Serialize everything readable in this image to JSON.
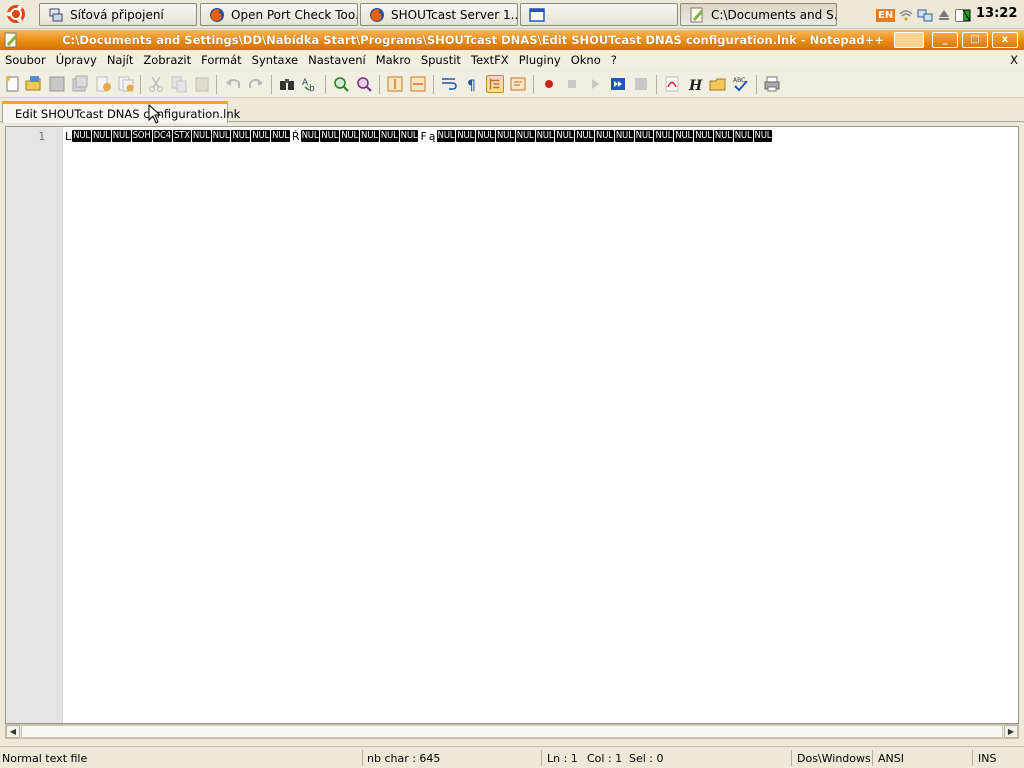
{
  "taskbar": {
    "buttons": [
      {
        "label": "Síťová připojení",
        "icon": "network-connections-icon"
      },
      {
        "label": "Open Port Check Too...",
        "icon": "firefox-icon"
      },
      {
        "label": "SHOUTcast Server 1....",
        "icon": "firefox-icon"
      },
      {
        "label": "",
        "icon": "window-icon"
      },
      {
        "label": "C:\\Documents and S...",
        "icon": "notepadpp-icon",
        "active": true
      }
    ],
    "tray": {
      "language": "EN",
      "clock": "13:22"
    }
  },
  "window": {
    "title": "C:\\Documents and Settings\\DD\\Nabídka Start\\Programs\\SHOUTcast DNAS\\Edit SHOUTcast DNAS configuration.lnk - Notepad++",
    "controls": [
      "_",
      "□",
      "x"
    ]
  },
  "menu": {
    "items": [
      "Soubor",
      "Úpravy",
      "Najít",
      "Zobrazit",
      "Formát",
      "Syntaxe",
      "Nastavení",
      "Makro",
      "Spustit",
      "TextFX",
      "Pluginy",
      "Okno",
      "?"
    ],
    "close": "X"
  },
  "tab": {
    "label": "Edit SHOUTcast DNAS configuration.lnk"
  },
  "editor": {
    "line_number": "1",
    "tokens": [
      {
        "t": "L",
        "ctrl": false
      },
      {
        "t": "NUL",
        "ctrl": true
      },
      {
        "t": "NUL",
        "ctrl": true
      },
      {
        "t": "NUL",
        "ctrl": true
      },
      {
        "t": "SOH",
        "ctrl": true
      },
      {
        "t": "DC4",
        "ctrl": true
      },
      {
        "t": "STX",
        "ctrl": true
      },
      {
        "t": "NUL",
        "ctrl": true
      },
      {
        "t": "NUL",
        "ctrl": true
      },
      {
        "t": "NUL",
        "ctrl": true
      },
      {
        "t": "NUL",
        "ctrl": true
      },
      {
        "t": "NUL",
        "ctrl": true
      },
      {
        "t": "Ŕ",
        "ctrl": false
      },
      {
        "t": "NUL",
        "ctrl": true
      },
      {
        "t": "NUL",
        "ctrl": true
      },
      {
        "t": "NUL",
        "ctrl": true
      },
      {
        "t": "NUL",
        "ctrl": true
      },
      {
        "t": "NUL",
        "ctrl": true
      },
      {
        "t": "NUL",
        "ctrl": true
      },
      {
        "t": "F",
        "ctrl": false
      },
      {
        "t": "ą",
        "ctrl": false
      },
      {
        "t": "NUL",
        "ctrl": true
      },
      {
        "t": "NUL",
        "ctrl": true
      },
      {
        "t": "NUL",
        "ctrl": true
      },
      {
        "t": "NUL",
        "ctrl": true
      },
      {
        "t": "NUL",
        "ctrl": true
      },
      {
        "t": "NUL",
        "ctrl": true
      },
      {
        "t": "NUL",
        "ctrl": true
      },
      {
        "t": "NUL",
        "ctrl": true
      },
      {
        "t": "NUL",
        "ctrl": true
      },
      {
        "t": "NUL",
        "ctrl": true
      },
      {
        "t": "NUL",
        "ctrl": true
      },
      {
        "t": "NUL",
        "ctrl": true
      },
      {
        "t": "NUL",
        "ctrl": true
      },
      {
        "t": "NUL",
        "ctrl": true
      },
      {
        "t": "NUL",
        "ctrl": true
      },
      {
        "t": "NUL",
        "ctrl": true
      },
      {
        "t": "NUL",
        "ctrl": true
      }
    ]
  },
  "status": {
    "file_type": "Normal text file",
    "nb_char": "nb char : 645",
    "ln": "Ln : 1",
    "col": "Col : 1",
    "sel": "Sel : 0",
    "eol": "Dos\\Windows",
    "encoding": "ANSI",
    "mode": "INS"
  },
  "colors": {
    "title_bar": "#e88910",
    "tab_accent": "#f5a623",
    "ctrl_char_bg": "#000000"
  }
}
